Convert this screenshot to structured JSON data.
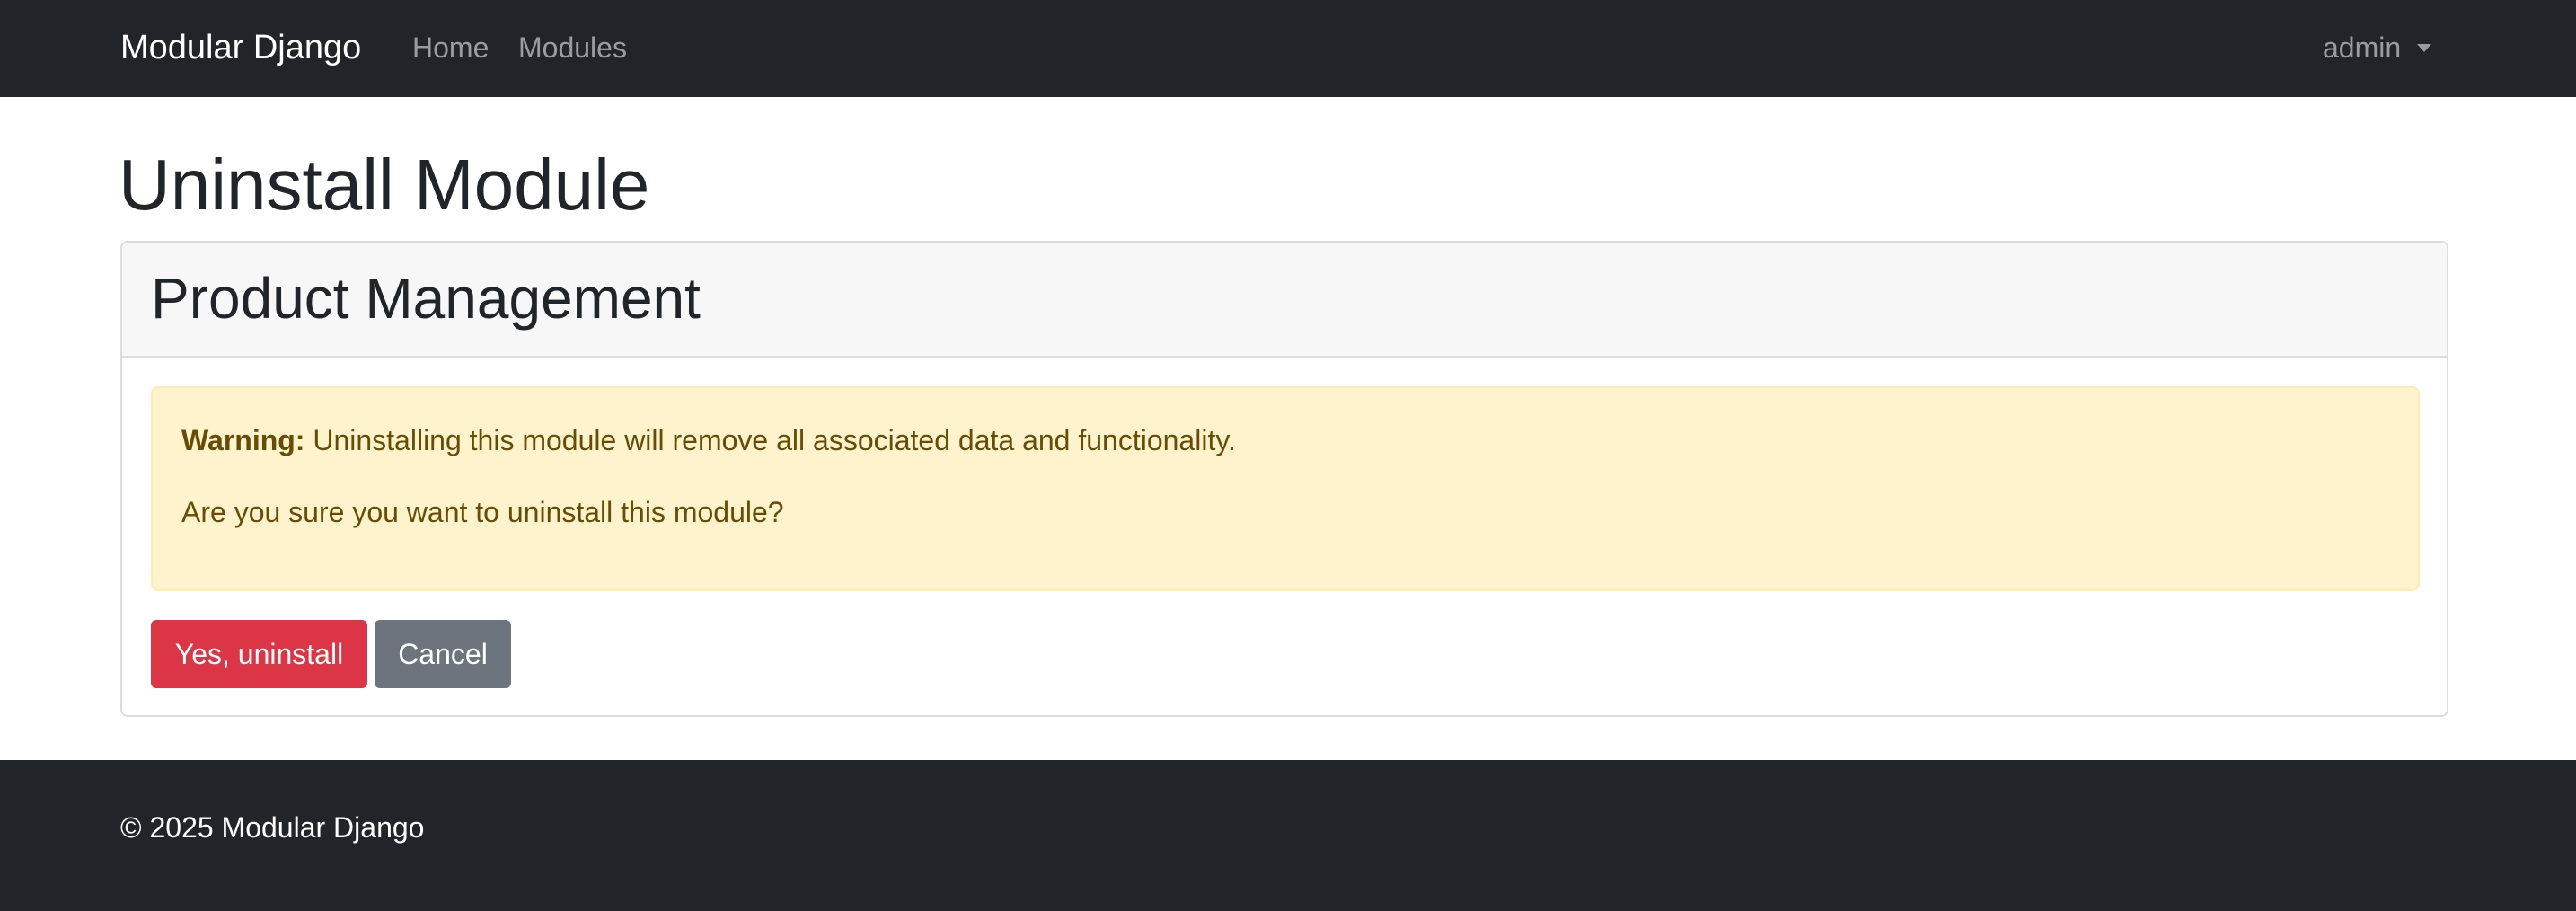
{
  "navbar": {
    "brand": "Modular Django",
    "links": [
      {
        "label": "Home"
      },
      {
        "label": "Modules"
      }
    ],
    "user": {
      "label": "admin"
    }
  },
  "page": {
    "title": "Uninstall Module"
  },
  "card": {
    "header": "Product Management",
    "alert": {
      "warning_label": "Warning:",
      "warning_text": "Uninstalling this module will remove all associated data and functionality.",
      "question": "Are you sure you want to uninstall this module?"
    },
    "buttons": {
      "confirm": "Yes, uninstall",
      "cancel": "Cancel"
    }
  },
  "footer": {
    "text": "© 2025 Modular Django"
  },
  "colors": {
    "navbar_bg": "#212529",
    "danger": "#dc3545",
    "secondary": "#6c757d",
    "warning_bg": "#fff3cd",
    "warning_text": "#664d03"
  },
  "icons": {
    "user_menu": "chevron-down-icon"
  }
}
